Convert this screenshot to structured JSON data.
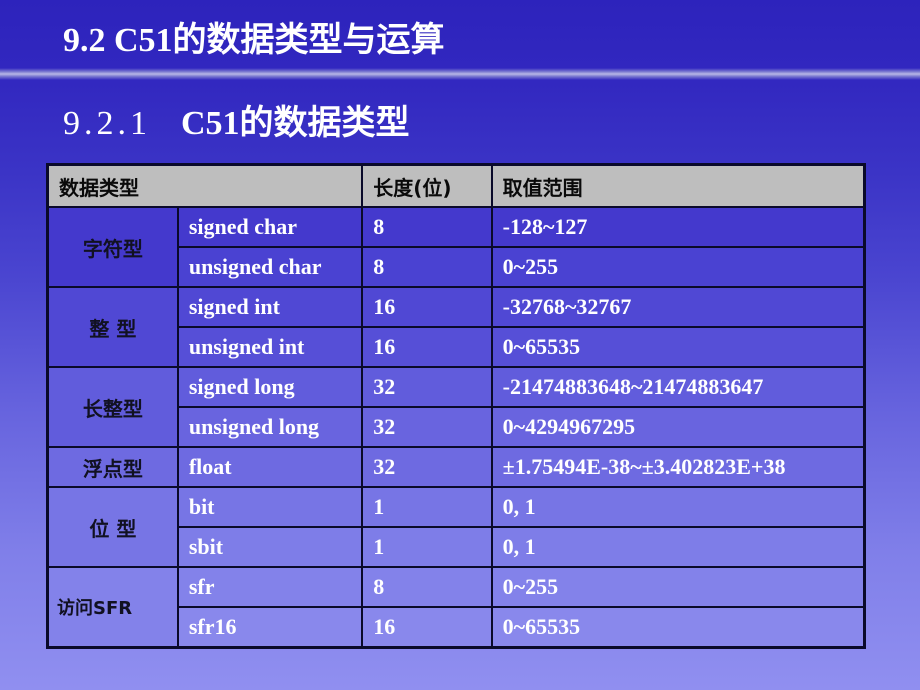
{
  "slide": {
    "title": "9.2   C51的数据类型与运算",
    "subtitle_number": "9.2.1",
    "subtitle_text": "C51的数据类型"
  },
  "table": {
    "headers": {
      "data_type": "数据类型",
      "length": "长度(位)",
      "range": "取值范围"
    },
    "groups": [
      {
        "category": "字符型",
        "rows": [
          {
            "type": "signed char",
            "length": "8",
            "range": "-128~127"
          },
          {
            "type": "unsigned char",
            "length": "8",
            "range": "0~255"
          }
        ]
      },
      {
        "category": "整  型",
        "rows": [
          {
            "type": "signed int",
            "length": "16",
            "range": "-32768~32767"
          },
          {
            "type": "unsigned int",
            "length": "16",
            "range": "0~65535"
          }
        ]
      },
      {
        "category": "长整型",
        "rows": [
          {
            "type": "signed long",
            "length": "32",
            "range": "-21474883648~21474883647"
          },
          {
            "type": "unsigned long",
            "length": "32",
            "range": "0~4294967295"
          }
        ]
      },
      {
        "category": "浮点型",
        "rows": [
          {
            "type": "float",
            "length": "32",
            "range": "±1.75494E-38~±3.402823E+38"
          }
        ]
      },
      {
        "category": "位  型",
        "rows": [
          {
            "type": "bit",
            "length": "1",
            "range": "0,  1"
          },
          {
            "type": "sbit",
            "length": "1",
            "range": "0,  1"
          }
        ]
      },
      {
        "category": "访问SFR",
        "rows": [
          {
            "type": "sfr",
            "length": "8",
            "range": "0~255"
          },
          {
            "type": "sfr16",
            "length": "16",
            "range": "0~65535"
          }
        ]
      }
    ]
  }
}
